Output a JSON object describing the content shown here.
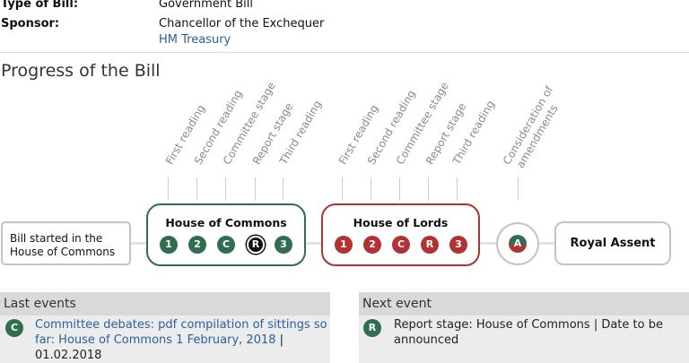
{
  "details": {
    "type_label": "Type of Bill:",
    "type_value": "Government Bill",
    "sponsor_label": "Sponsor:",
    "sponsor_value": "Chancellor of the Exchequer",
    "sponsor_link": "HM Treasury"
  },
  "progress": {
    "title": "Progress of the Bill",
    "start_box": [
      "Bill started in the",
      "House of Commons"
    ],
    "commons": {
      "title": "House of Commons",
      "stages": [
        {
          "heading": "First reading",
          "symbol": "1",
          "state": "done"
        },
        {
          "heading": "Second reading",
          "symbol": "2",
          "state": "done"
        },
        {
          "heading": "Committee stage",
          "symbol": "C",
          "state": "done"
        },
        {
          "heading": "Report stage",
          "symbol": "R",
          "state": "current"
        },
        {
          "heading": "Third reading",
          "symbol": "3",
          "state": "done"
        }
      ]
    },
    "lords": {
      "title": "House of Lords",
      "stages": [
        {
          "heading": "First reading",
          "symbol": "1"
        },
        {
          "heading": "Second reading",
          "symbol": "2"
        },
        {
          "heading": "Committee stage",
          "symbol": "C"
        },
        {
          "heading": "Report stage",
          "symbol": "R"
        },
        {
          "heading": "Third reading",
          "symbol": "3"
        }
      ]
    },
    "amendments": {
      "heading": [
        "Consideration of",
        "amendments"
      ],
      "symbol": "A"
    },
    "royal_assent": "Royal Assent"
  },
  "last_events": {
    "heading": "Last events",
    "icon": "C",
    "link": "Committee debates: pdf compilation of sittings so far: House of Commons 1 February, 2018",
    "separator": "|",
    "date": "01.02.2018"
  },
  "next_event": {
    "heading": "Next event",
    "icon": "R",
    "text": "Report stage: House of Commons | Date to be announced"
  },
  "colors": {
    "commons": "#2f6e4e",
    "lords": "#b23132",
    "current": "#111111"
  }
}
